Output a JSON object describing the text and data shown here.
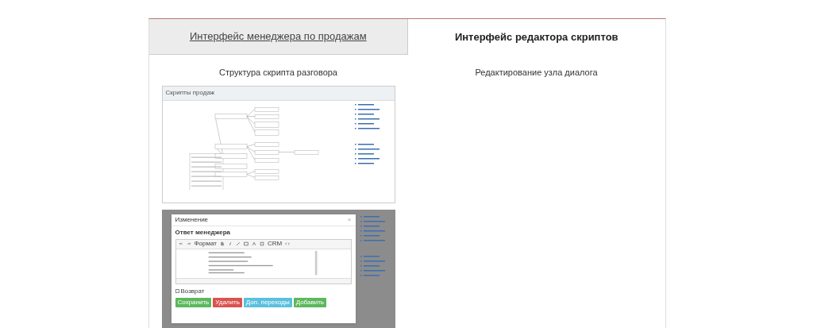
{
  "tabs": [
    {
      "label": "Интерфейс менеджера по продажам",
      "selected": false
    },
    {
      "label": "Интерфейс редактора скриптов",
      "selected": true
    }
  ],
  "columns": [
    {
      "heading": "Структура скрипта разговора"
    },
    {
      "heading": "Редактирование узла диалога"
    }
  ],
  "script_tree_screenshot": {
    "title": "Скрипты продаж"
  },
  "editor_screenshot": {
    "dialog_title": "Изменение",
    "close": "×",
    "field_label": "Ответ менеджера",
    "toolbar_format": "Формат",
    "toolbar_crm": "CRM",
    "checkbox": {
      "label": "Возврат",
      "checked": false
    },
    "buttons": [
      {
        "label": "Сохранить",
        "color": "#5cb85c"
      },
      {
        "label": "Удалить",
        "color": "#d9534f"
      },
      {
        "label": "Доп. переходы",
        "color": "#5bc0de"
      },
      {
        "label": "Добавить",
        "color": "#5cb85c"
      }
    ]
  }
}
